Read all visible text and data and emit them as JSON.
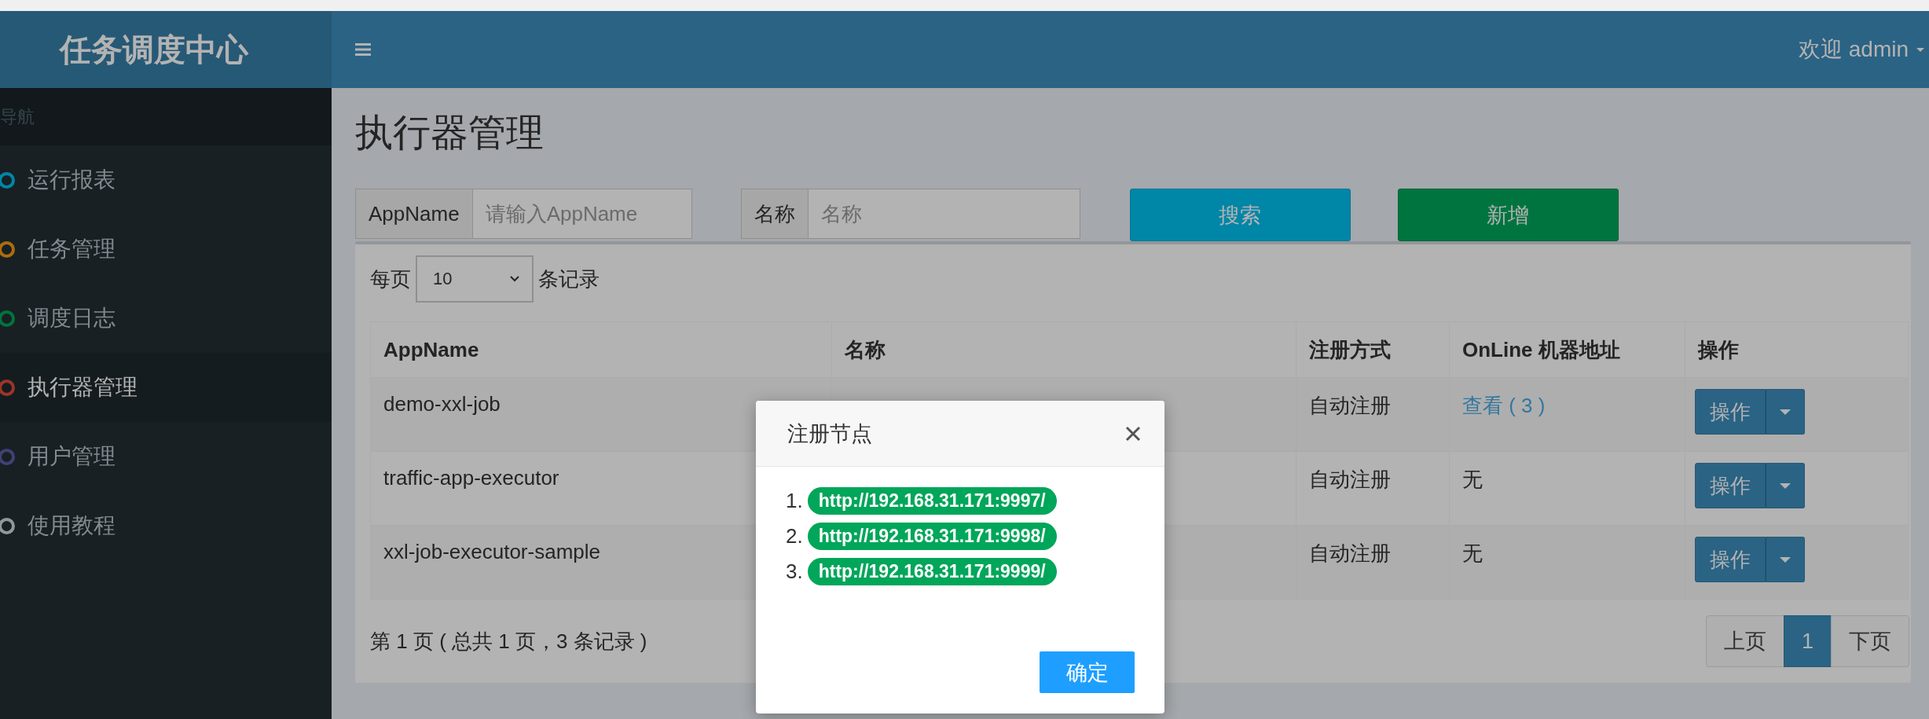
{
  "header": {
    "logo": "任务调度中心",
    "user": "欢迎 admin"
  },
  "sidebar": {
    "heading": "导航",
    "items": [
      {
        "label": "运行报表",
        "color": "#0086a7",
        "selected": false
      },
      {
        "label": "任务管理",
        "color": "#aa6d0d",
        "selected": false
      },
      {
        "label": "调度日志",
        "color": "#00743f",
        "selected": false
      },
      {
        "label": "执行器管理",
        "color": "#9b3528",
        "selected": true
      },
      {
        "label": "用户管理",
        "color": "#434076",
        "selected": false
      },
      {
        "label": "使用教程",
        "color": "#93969b",
        "selected": false
      }
    ]
  },
  "page_title": "执行器管理",
  "filters": [
    {
      "label": "AppName",
      "placeholder": "请输入AppName"
    },
    {
      "label": "名称",
      "placeholder": "名称"
    }
  ],
  "buttons": [
    {
      "label": "搜索",
      "kind": "search"
    },
    {
      "label": "新增",
      "kind": "add"
    }
  ],
  "page_size": {
    "prefix": "每页",
    "value": "10",
    "suffix": "条记录"
  },
  "table": {
    "columns": [
      "AppName",
      "名称",
      "注册方式",
      "OnLine 机器地址",
      "操作"
    ],
    "rows": [
      {
        "appname": "demo-xxl-job",
        "registration": "自动注册",
        "online": {
          "kind": "link",
          "text": "查看 ( 3 )"
        },
        "action": "操作"
      },
      {
        "appname": "traffic-app-executor",
        "registration": "自动注册",
        "online": {
          "kind": "text",
          "text": "无"
        },
        "action": "操作"
      },
      {
        "appname": "xxl-job-executor-sample",
        "registration": "自动注册",
        "online": {
          "kind": "text",
          "text": "无"
        },
        "action": "操作"
      }
    ]
  },
  "footer": "第 1 页 ( 总共 1 页，3 条记录 )",
  "pagination": [
    {
      "label": "上页",
      "selected": false
    },
    {
      "label": "1",
      "selected": true
    },
    {
      "label": "下页",
      "selected": false
    }
  ],
  "modal": {
    "title": "注册节点",
    "items": [
      {
        "number": "1.",
        "url": "http://192.168.31.171:9997/"
      },
      {
        "number": "2.",
        "url": "http://192.168.31.171:9998/"
      },
      {
        "number": "3.",
        "url": "http://192.168.31.171:9999/"
      }
    ],
    "button": "确定"
  }
}
